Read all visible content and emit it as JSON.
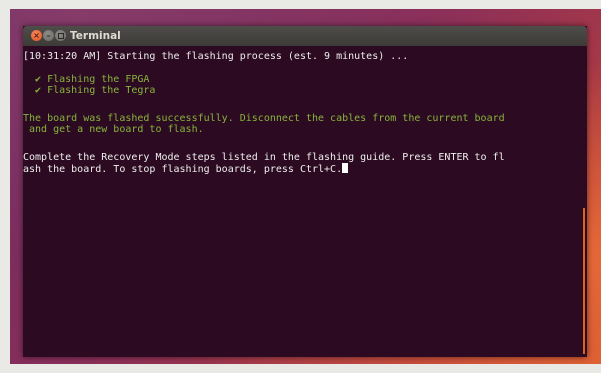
{
  "window": {
    "title": "Terminal"
  },
  "terminal": {
    "lines": [
      "[10:31:20 AM] Starting the flashing process (est. 9 minutes) ...",
      "  ✔ Flashing the FPGA",
      "  ✔ Flashing the Tegra",
      "The board was flashed successfully. Disconnect the cables from the current board",
      " and get a new board to flash.",
      "Complete the Recovery Mode steps listed in the flashing guide. Press ENTER to fl",
      "ash the board. To stop flashing boards, press Ctrl+C."
    ]
  },
  "colors": {
    "terminal_background": "#2c0b22",
    "text_white": "#eeeeec",
    "text_green": "#87b43a",
    "scrollbar_accent": "#d4691e",
    "close_button": "#e3501f"
  }
}
